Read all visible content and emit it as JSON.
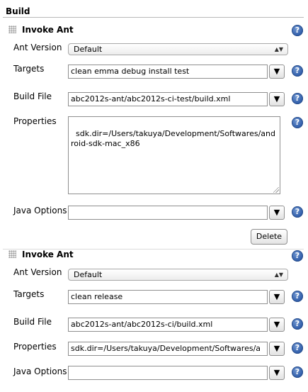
{
  "section": {
    "title": "Build"
  },
  "icons": {
    "help": "question-mark-circle-icon",
    "grip": "drag-handle-icon",
    "dropdown": "chevron-down-icon"
  },
  "blocks": [
    {
      "title": "Invoke Ant",
      "ant_version": {
        "label": "Ant Version",
        "value": "Default"
      },
      "targets": {
        "label": "Targets",
        "value": "clean emma debug install test"
      },
      "build_file": {
        "label": "Build File",
        "value": "abc2012s-ant/abc2012s-ci-test/build.xml"
      },
      "properties": {
        "label": "Properties",
        "value": "sdk.dir=/Users/takuya/Development/Softwares/android-sdk-mac_x86"
      },
      "java_options": {
        "label": "Java Options",
        "value": ""
      },
      "delete_label": "Delete"
    },
    {
      "title": "Invoke Ant",
      "ant_version": {
        "label": "Ant Version",
        "value": "Default"
      },
      "targets": {
        "label": "Targets",
        "value": "clean release"
      },
      "build_file": {
        "label": "Build File",
        "value": "abc2012s-ant/abc2012s-ci/build.xml"
      },
      "properties": {
        "label": "Properties",
        "value": "sdk.dir=/Users/takuya/Development/Softwares/a"
      },
      "java_options": {
        "label": "Java Options",
        "value": ""
      }
    }
  ]
}
